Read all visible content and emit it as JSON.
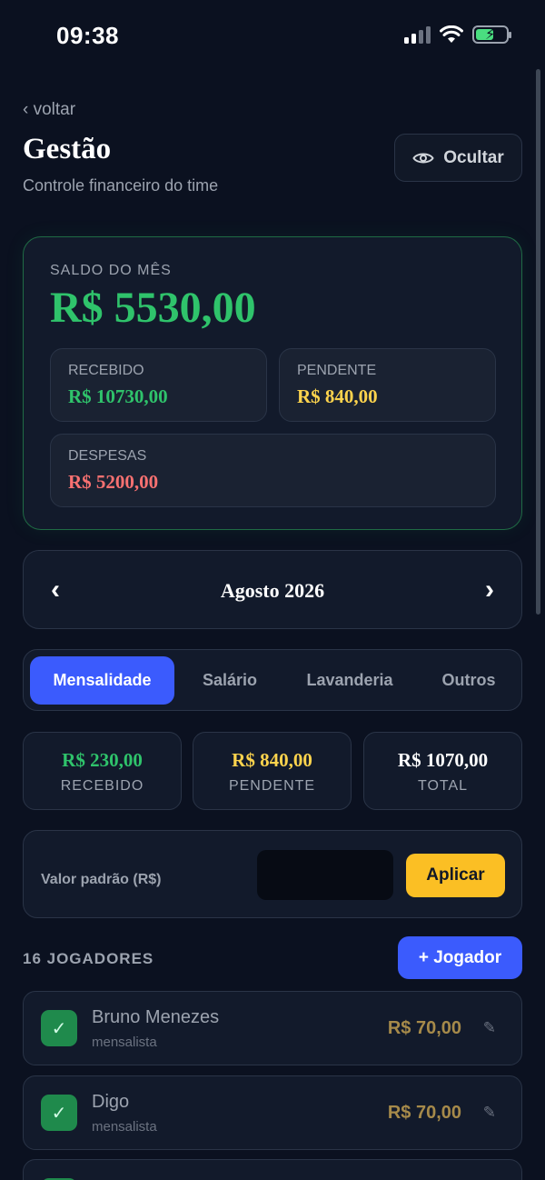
{
  "status_bar": {
    "time": "09:38"
  },
  "header": {
    "back_label": "‹ voltar",
    "title": "Gestão",
    "subtitle": "Controle financeiro do time",
    "hide_label": "Ocultar"
  },
  "balance": {
    "label": "SALDO DO MÊS",
    "value": "R$ 5530,00",
    "received_label": "RECEBIDO",
    "received_value": "R$ 10730,00",
    "pending_label": "PENDENTE",
    "pending_value": "R$ 840,00",
    "expenses_label": "DESPESAS",
    "expenses_value": "R$ 5200,00"
  },
  "month": {
    "prev": "‹",
    "label": "Agosto 2026",
    "next": "›"
  },
  "tabs": [
    {
      "label": "Mensalidade",
      "active": true
    },
    {
      "label": "Salário",
      "active": false
    },
    {
      "label": "Lavanderia",
      "active": false
    },
    {
      "label": "Outros",
      "active": false
    }
  ],
  "summary": {
    "received_value": "R$ 230,00",
    "received_label": "RECEBIDO",
    "pending_value": "R$ 840,00",
    "pending_label": "PENDENTE",
    "total_value": "R$ 1070,00",
    "total_label": "TOTAL"
  },
  "default_value": {
    "label": "Valor padrão (R$)",
    "input_value": "",
    "apply_label": "Aplicar"
  },
  "players": {
    "count_label": "16 JOGADORES",
    "add_label": "+ Jogador",
    "items": [
      {
        "name": "Bruno Menezes",
        "type": "mensalista",
        "amount": "R$ 70,00"
      },
      {
        "name": "Digo",
        "type": "mensalista",
        "amount": "R$ 70,00"
      }
    ]
  },
  "colors": {
    "background": "#0b1120",
    "green": "#2fc36b",
    "yellow": "#fcd34d",
    "red": "#f87171",
    "blue": "#3b5bfd",
    "amber_button": "#fbbf24"
  },
  "icons": {
    "eye": "eye-icon",
    "check": "check-icon",
    "edit": "pencil-icon"
  }
}
